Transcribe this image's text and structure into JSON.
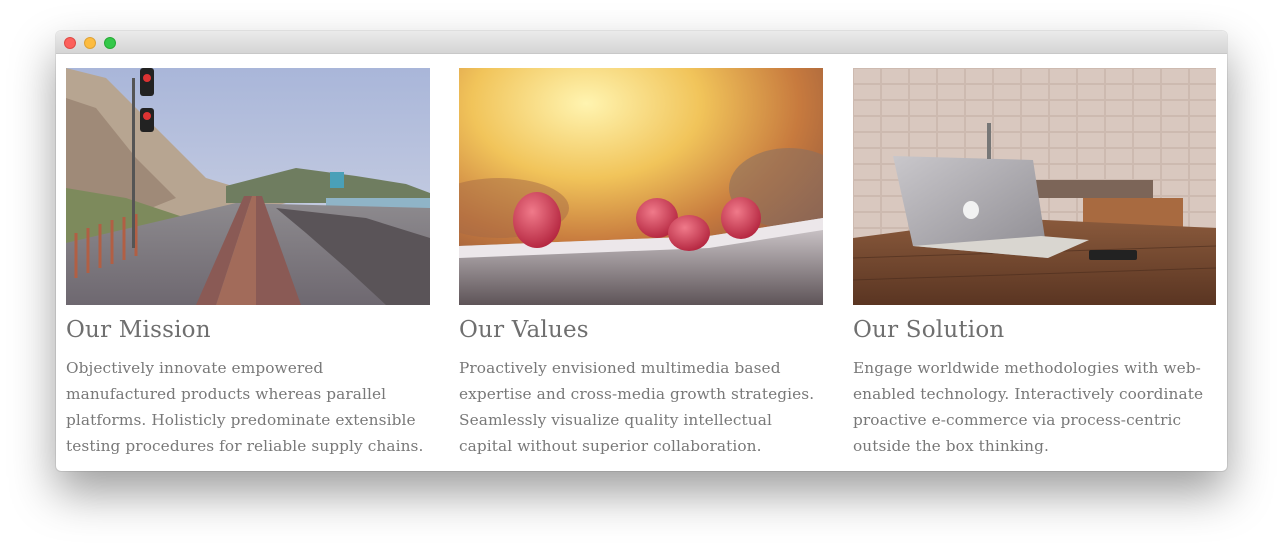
{
  "window": {
    "controls": [
      "close",
      "minimize",
      "maximize"
    ]
  },
  "columns": [
    {
      "title": "Our Mission",
      "image": "railroad-track-coast-photo",
      "text": "Objectively innovate empowered manufactured products whereas parallel platforms. Holisticly predominate extensible testing procedures for reliable supply chains."
    },
    {
      "title": "Our Values",
      "image": "raspberries-on-railing-photo",
      "text": "Proactively envisioned multimedia based expertise and cross-media growth strategies. Seamlessly visualize quality intellectual capital without superior collaboration."
    },
    {
      "title": "Our Solution",
      "image": "laptop-on-wooden-table-photo",
      "text": "Engage worldwide methodologies with web-enabled technology. Interactively coordinate proactive e-commerce via process-centric outside the box thinking."
    }
  ],
  "colors": {
    "heading": "#6f6f6f",
    "body_text": "#787878",
    "close_dot": "#fc605c",
    "minimize_dot": "#fdbc40",
    "maximize_dot": "#34c84a"
  }
}
